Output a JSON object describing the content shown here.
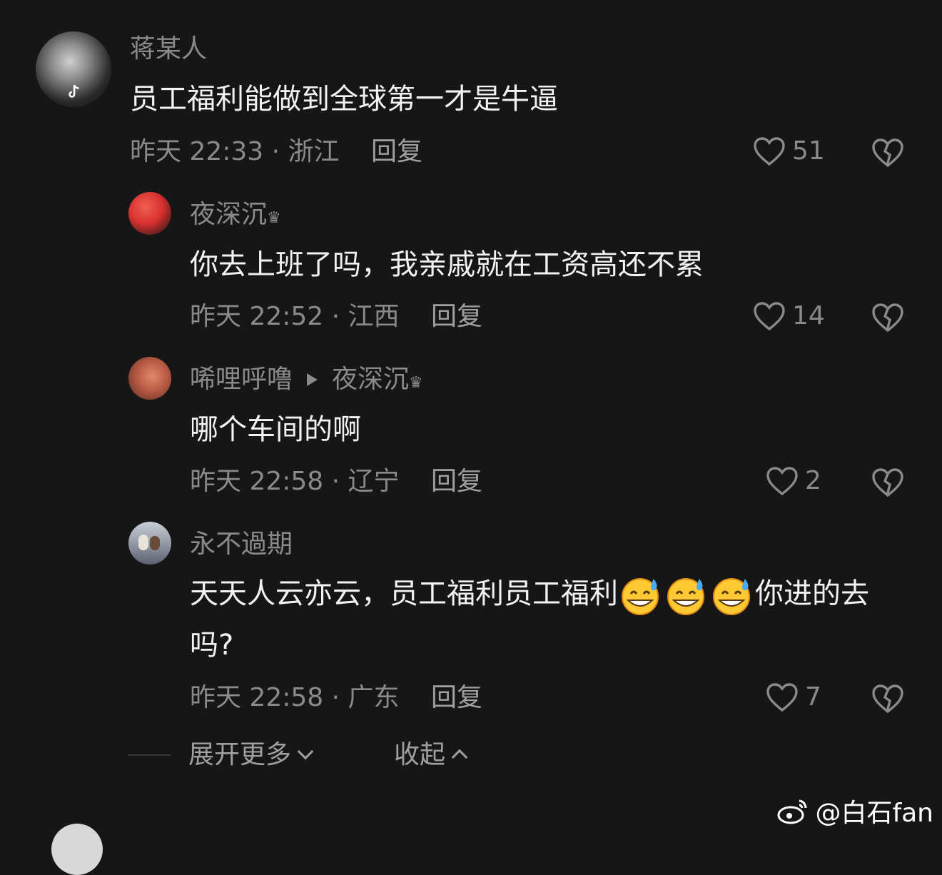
{
  "comments": [
    {
      "username": "蒋某人",
      "text": "员工福利能做到全球第一才是牛逼",
      "time": "昨天 22:33 · 浙江",
      "reply": "回复",
      "likes": "51"
    },
    {
      "username": "夜深沉",
      "badge": "♛",
      "text": "你去上班了吗，我亲戚就在工资高还不累",
      "time": "昨天 22:52 · 江西",
      "reply": "回复",
      "likes": "14"
    },
    {
      "username": "唏哩呼噜",
      "reply_to": "夜深沉",
      "badge": "♛",
      "text": "哪个车间的啊",
      "time": "昨天 22:58 · 辽宁",
      "reply": "回复",
      "likes": "2"
    },
    {
      "username": "永不過期",
      "text_a": "天天人云亦云，员工福利员工福利",
      "text_b": "你进的去吗?",
      "emoji": "grinning-sweat-emoji",
      "time": "昨天 22:58 · 广东",
      "reply": "回复",
      "likes": "7"
    }
  ],
  "footer": {
    "expand": "展开更多",
    "collapse": "收起"
  },
  "watermark": "@白石fan",
  "colors": {
    "background": "#161616",
    "muted": "#8a8a8a",
    "text": "#f2f2f2"
  }
}
